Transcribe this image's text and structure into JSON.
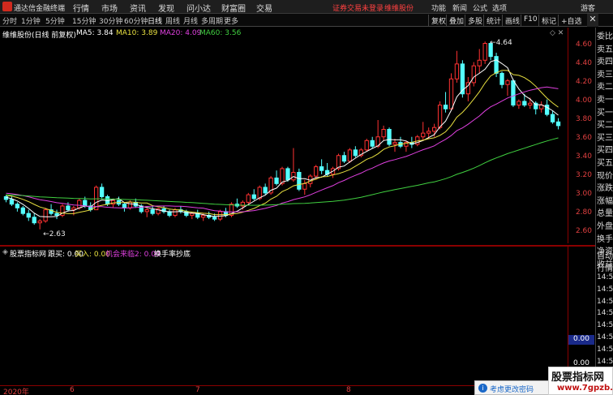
{
  "app": {
    "name": "通达信金融终端"
  },
  "menu": [
    "行情",
    "市场",
    "资讯",
    "发现",
    "问小达",
    "财富圈",
    "交易"
  ],
  "status": {
    "login": "证券交易未登录",
    "stock": "维维股份"
  },
  "right_menu": [
    "功能",
    "新闻",
    "公式",
    "选项",
    "游客"
  ],
  "periods": [
    "分时",
    "1分钟",
    "5分钟",
    "15分钟",
    "30分钟",
    "60分钟",
    "日线",
    "周线",
    "月线",
    "多周期",
    "更多"
  ],
  "active_period": "日线",
  "right_buttons": [
    "复权",
    "叠加",
    "多股",
    "统计",
    "画线",
    "F10",
    "标记",
    "+自选"
  ],
  "chart_title": "维维股份(日线 前复权)",
  "ma_legend": [
    {
      "label": "MA5: 3.84",
      "color": "#ffffff"
    },
    {
      "label": "MA10: 3.89",
      "color": "#e8e040"
    },
    {
      "label": "MA20: 4.09",
      "color": "#e040e0"
    },
    {
      "label": "MA60: 3.56",
      "color": "#40d040"
    }
  ],
  "indicator_legend": [
    {
      "label": "股票指标网",
      "color": "#ffffff"
    },
    {
      "label": "跟买: 0.00",
      "color": "#ffffff"
    },
    {
      "label": "买入: 0.00",
      "color": "#e8e040"
    },
    {
      "label": "机会来临2: 0.00",
      "color": "#e040e0"
    },
    {
      "label": "换手率抄底",
      "color": "#ffffff"
    }
  ],
  "price_axis": [
    "4.60",
    "4.40",
    "4.20",
    "4.00",
    "3.80",
    "3.60",
    "3.40",
    "3.20",
    "3.00",
    "2.80",
    "2.60"
  ],
  "annotations": {
    "high": "4.64",
    "low": "2.63"
  },
  "side_labels": [
    "委比",
    "卖五",
    "卖四",
    "卖三",
    "卖二",
    "卖一",
    "买一",
    "买二",
    "买三",
    "买四",
    "买五",
    "现价",
    "涨跌",
    "涨幅",
    "总量",
    "外盘",
    "换手",
    "净资",
    "收益"
  ],
  "side_labels2": [
    "自动",
    "行情"
  ],
  "side_times": [
    "14:5",
    "14:5",
    "14:5",
    "14:5",
    "14:5",
    "14:5",
    "14:5",
    "14:5",
    "14:5",
    "14:5"
  ],
  "indicator_axis": [
    "0.00",
    "0.00"
  ],
  "date_axis": [
    "2020年",
    "6",
    "7",
    "8"
  ],
  "toast": {
    "text": "考虑更改密码"
  },
  "watermark": {
    "title": "股票指标网",
    "url": "www.7gpzb.com"
  },
  "colors": {
    "up": "#ff3232",
    "down": "#54ffff",
    "ma5": "#ffffff",
    "ma10": "#e8e040",
    "ma20": "#e040e0",
    "ma60": "#40d040"
  },
  "chart_data": {
    "type": "candlestick",
    "ylim": [
      2.55,
      4.72
    ],
    "candles": [
      [
        2.98,
        3.0,
        2.92,
        2.95
      ],
      [
        2.95,
        2.99,
        2.88,
        2.9
      ],
      [
        2.9,
        2.92,
        2.82,
        2.86
      ],
      [
        2.86,
        2.88,
        2.78,
        2.8
      ],
      [
        2.8,
        2.84,
        2.72,
        2.76
      ],
      [
        2.76,
        2.8,
        2.68,
        2.7
      ],
      [
        2.7,
        2.74,
        2.63,
        2.72
      ],
      [
        2.72,
        2.86,
        2.7,
        2.84
      ],
      [
        2.84,
        2.9,
        2.78,
        2.8
      ],
      [
        2.8,
        2.84,
        2.74,
        2.78
      ],
      [
        2.78,
        2.9,
        2.76,
        2.88
      ],
      [
        2.88,
        2.92,
        2.82,
        2.84
      ],
      [
        2.84,
        2.88,
        2.78,
        2.86
      ],
      [
        2.86,
        2.96,
        2.84,
        2.94
      ],
      [
        2.94,
        2.98,
        2.86,
        2.88
      ],
      [
        2.88,
        2.92,
        2.82,
        2.84
      ],
      [
        2.84,
        3.1,
        2.84,
        3.08
      ],
      [
        3.08,
        3.12,
        2.96,
        2.98
      ],
      [
        2.98,
        3.0,
        2.88,
        2.9
      ],
      [
        2.9,
        2.96,
        2.86,
        2.94
      ],
      [
        2.94,
        2.98,
        2.88,
        2.9
      ],
      [
        2.9,
        2.92,
        2.82,
        2.86
      ],
      [
        2.86,
        2.94,
        2.84,
        2.92
      ],
      [
        2.92,
        2.96,
        2.86,
        2.88
      ],
      [
        2.88,
        2.9,
        2.8,
        2.82
      ],
      [
        2.82,
        2.86,
        2.76,
        2.84
      ],
      [
        2.84,
        2.88,
        2.78,
        2.8
      ],
      [
        2.8,
        2.86,
        2.78,
        2.85
      ],
      [
        2.85,
        2.88,
        2.8,
        2.82
      ],
      [
        2.82,
        2.84,
        2.76,
        2.78
      ],
      [
        2.78,
        2.86,
        2.76,
        2.84
      ],
      [
        2.84,
        2.88,
        2.8,
        2.82
      ],
      [
        2.82,
        2.84,
        2.76,
        2.78
      ],
      [
        2.78,
        2.82,
        2.74,
        2.8
      ],
      [
        2.8,
        2.84,
        2.74,
        2.76
      ],
      [
        2.76,
        2.8,
        2.72,
        2.78
      ],
      [
        2.78,
        2.82,
        2.74,
        2.76
      ],
      [
        2.76,
        2.8,
        2.72,
        2.74
      ],
      [
        2.74,
        2.84,
        2.72,
        2.82
      ],
      [
        2.82,
        2.86,
        2.76,
        2.78
      ],
      [
        2.78,
        2.92,
        2.76,
        2.9
      ],
      [
        2.9,
        2.96,
        2.86,
        2.88
      ],
      [
        2.88,
        2.94,
        2.84,
        2.92
      ],
      [
        2.92,
        3.02,
        2.9,
        3.0
      ],
      [
        3.0,
        3.06,
        2.94,
        2.96
      ],
      [
        2.96,
        3.1,
        2.94,
        3.08
      ],
      [
        3.08,
        3.12,
        3.0,
        3.02
      ],
      [
        3.02,
        3.2,
        3.0,
        3.18
      ],
      [
        3.18,
        3.26,
        3.1,
        3.12
      ],
      [
        3.12,
        3.3,
        3.1,
        3.28
      ],
      [
        3.28,
        3.3,
        3.14,
        3.16
      ],
      [
        3.16,
        3.5,
        3.14,
        3.24
      ],
      [
        3.24,
        3.28,
        3.04,
        3.06
      ],
      [
        3.06,
        3.16,
        3.0,
        3.12
      ],
      [
        3.12,
        3.22,
        3.08,
        3.2
      ],
      [
        3.2,
        3.32,
        3.16,
        3.3
      ],
      [
        3.3,
        3.38,
        3.22,
        3.26
      ],
      [
        3.26,
        3.34,
        3.2,
        3.22
      ],
      [
        3.22,
        3.3,
        3.18,
        3.28
      ],
      [
        3.28,
        3.44,
        3.26,
        3.42
      ],
      [
        3.42,
        3.46,
        3.34,
        3.36
      ],
      [
        3.36,
        3.5,
        3.34,
        3.48
      ],
      [
        3.48,
        3.52,
        3.4,
        3.42
      ],
      [
        3.42,
        3.5,
        3.4,
        3.48
      ],
      [
        3.48,
        3.6,
        3.46,
        3.58
      ],
      [
        3.58,
        3.62,
        3.5,
        3.52
      ],
      [
        3.52,
        3.8,
        3.5,
        3.62
      ],
      [
        3.62,
        3.74,
        3.58,
        3.7
      ],
      [
        3.7,
        3.72,
        3.52,
        3.54
      ],
      [
        3.54,
        3.6,
        3.46,
        3.56
      ],
      [
        3.56,
        3.62,
        3.5,
        3.52
      ],
      [
        3.52,
        3.58,
        3.46,
        3.56
      ],
      [
        3.56,
        3.62,
        3.5,
        3.54
      ],
      [
        3.54,
        3.64,
        3.52,
        3.62
      ],
      [
        3.62,
        3.78,
        3.58,
        3.66
      ],
      [
        3.66,
        3.72,
        3.6,
        3.68
      ],
      [
        3.68,
        3.76,
        3.62,
        3.72
      ],
      [
        3.72,
        4.0,
        3.7,
        3.96
      ],
      [
        3.96,
        4.1,
        3.88,
        3.92
      ],
      [
        3.92,
        4.3,
        3.9,
        4.24
      ],
      [
        4.24,
        4.54,
        4.2,
        4.4
      ],
      [
        4.4,
        4.44,
        4.04,
        4.08
      ],
      [
        4.08,
        4.26,
        4.0,
        4.2
      ],
      [
        4.2,
        4.42,
        4.16,
        4.38
      ],
      [
        4.38,
        4.56,
        4.3,
        4.44
      ],
      [
        4.44,
        4.64,
        4.4,
        4.62
      ],
      [
        4.62,
        4.64,
        4.44,
        4.48
      ],
      [
        4.48,
        4.52,
        4.26,
        4.3
      ],
      [
        4.3,
        4.32,
        4.14,
        4.18
      ],
      [
        4.18,
        4.24,
        4.06,
        4.22
      ],
      [
        4.22,
        4.24,
        3.94,
        3.96
      ],
      [
        3.96,
        4.02,
        3.92,
        4.0
      ],
      [
        4.0,
        4.08,
        3.94,
        3.96
      ],
      [
        3.96,
        4.04,
        3.92,
        3.98
      ],
      [
        3.98,
        4.0,
        3.86,
        3.92
      ],
      [
        3.92,
        4.0,
        3.88,
        3.96
      ],
      [
        3.96,
        4.02,
        3.84,
        3.86
      ],
      [
        3.86,
        3.9,
        3.76,
        3.78
      ],
      [
        3.78,
        3.82,
        3.7,
        3.74
      ]
    ]
  }
}
